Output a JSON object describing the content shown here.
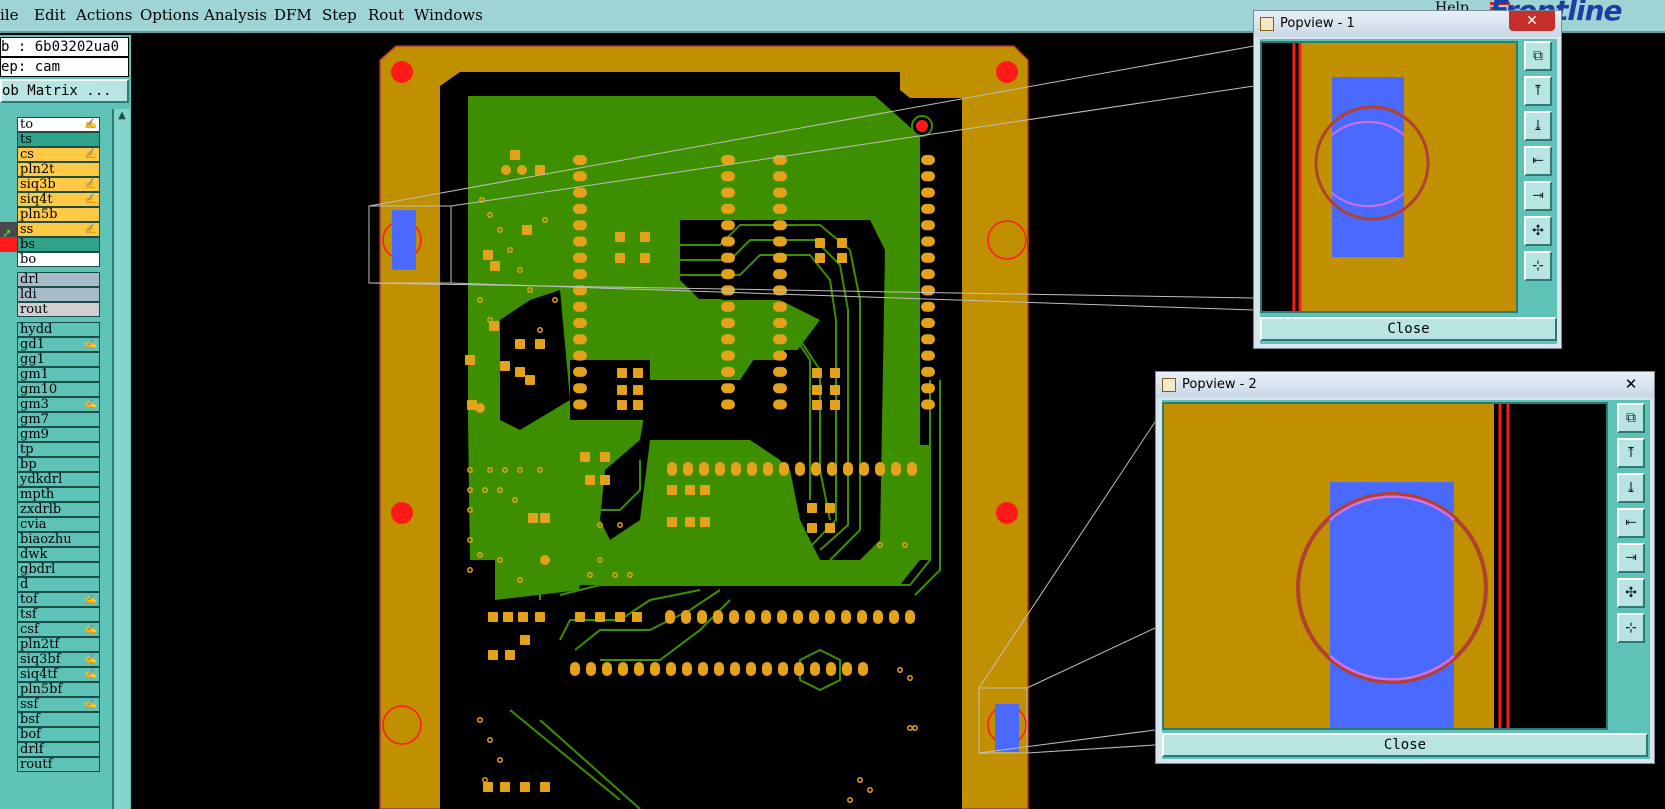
{
  "menus": [
    {
      "label": "File",
      "shown": "ile"
    },
    {
      "label": "Edit"
    },
    {
      "label": "Actions"
    },
    {
      "label": "Options"
    },
    {
      "label": "Analysis"
    },
    {
      "label": "DFM"
    },
    {
      "label": "Step"
    },
    {
      "label": "Rout"
    },
    {
      "label": "Windows"
    }
  ],
  "help": "Help",
  "brand": "Frontline",
  "job_line": "b : 6b03202ua0",
  "step_line": "ep: cam",
  "matrix_button": "ob Matrix ...",
  "layers": [
    {
      "name": "to",
      "color": "#ffffff",
      "affect": true
    },
    {
      "name": "ts",
      "color": "#2fa388"
    },
    {
      "name": "cs",
      "color": "#ffc845",
      "affect": true
    },
    {
      "name": "pln2t",
      "color": "#ffc845"
    },
    {
      "name": "siq3b",
      "color": "#ffc845",
      "affect": true
    },
    {
      "name": "siq4t",
      "color": "#ffc845",
      "affect": true
    },
    {
      "name": "pln5b",
      "color": "#ffc845"
    },
    {
      "name": "ss",
      "color": "#ffc845",
      "affect": true,
      "work": true
    },
    {
      "name": "bs",
      "color": "#2fa388",
      "display": true
    },
    {
      "name": "bo",
      "color": "#ffffff"
    },
    {
      "name": "drl",
      "color": "#a8bcc8",
      "gap": true
    },
    {
      "name": "ldi",
      "color": "#a8bcc8"
    },
    {
      "name": "rout",
      "color": "#d0d0d0"
    },
    {
      "name": "hydd",
      "color": "#5fc2b6",
      "gap": true
    },
    {
      "name": "gd1",
      "color": "#5fc2b6",
      "affect": true
    },
    {
      "name": "gg1",
      "color": "#5fc2b6"
    },
    {
      "name": "gm1",
      "color": "#5fc2b6"
    },
    {
      "name": "gm10",
      "color": "#5fc2b6"
    },
    {
      "name": "gm3",
      "color": "#5fc2b6",
      "affect": true
    },
    {
      "name": "gm7",
      "color": "#5fc2b6"
    },
    {
      "name": "gm9",
      "color": "#5fc2b6"
    },
    {
      "name": "tp",
      "color": "#5fc2b6"
    },
    {
      "name": "bp",
      "color": "#5fc2b6"
    },
    {
      "name": "ydkdrl",
      "color": "#5fc2b6"
    },
    {
      "name": "mpth",
      "color": "#5fc2b6"
    },
    {
      "name": "zxdrlb",
      "color": "#5fc2b6"
    },
    {
      "name": "cvia",
      "color": "#5fc2b6"
    },
    {
      "name": "biaozhu",
      "color": "#5fc2b6"
    },
    {
      "name": "dwk",
      "color": "#5fc2b6"
    },
    {
      "name": "gbdrl",
      "color": "#5fc2b6"
    },
    {
      "name": "d",
      "color": "#5fc2b6"
    },
    {
      "name": "tof",
      "color": "#5fc2b6",
      "affect": true
    },
    {
      "name": "tsf",
      "color": "#5fc2b6"
    },
    {
      "name": "csf",
      "color": "#5fc2b6",
      "affect": true
    },
    {
      "name": "pln2tf",
      "color": "#5fc2b6"
    },
    {
      "name": "siq3bf",
      "color": "#5fc2b6",
      "affect": true
    },
    {
      "name": "siq4tf",
      "color": "#5fc2b6",
      "affect": true
    },
    {
      "name": "pln5bf",
      "color": "#5fc2b6"
    },
    {
      "name": "ssf",
      "color": "#5fc2b6",
      "affect": true
    },
    {
      "name": "bsf",
      "color": "#5fc2b6"
    },
    {
      "name": "bof",
      "color": "#5fc2b6"
    },
    {
      "name": "drlf",
      "color": "#5fc2b6"
    },
    {
      "name": "routf",
      "color": "#5fc2b6"
    }
  ],
  "popups": [
    {
      "title": "Popview - 1",
      "close": "Close"
    },
    {
      "title": "Popview - 2",
      "close": "Close"
    }
  ],
  "colors": {
    "copper": "#c09000",
    "board": "#3e8f00",
    "void": "#000000",
    "fiducial": "#ff1a1a",
    "pad": "#e3a21a",
    "selection": "#4a6aff",
    "ui_panel": "#5fc2b6"
  },
  "toolbar_icons": [
    "window-new-icon",
    "zoom-home-icon",
    "zoom-previous-icon",
    "pan-left-icon",
    "pan-right-icon",
    "zoom-in-icon",
    "zoom-out-icon"
  ]
}
